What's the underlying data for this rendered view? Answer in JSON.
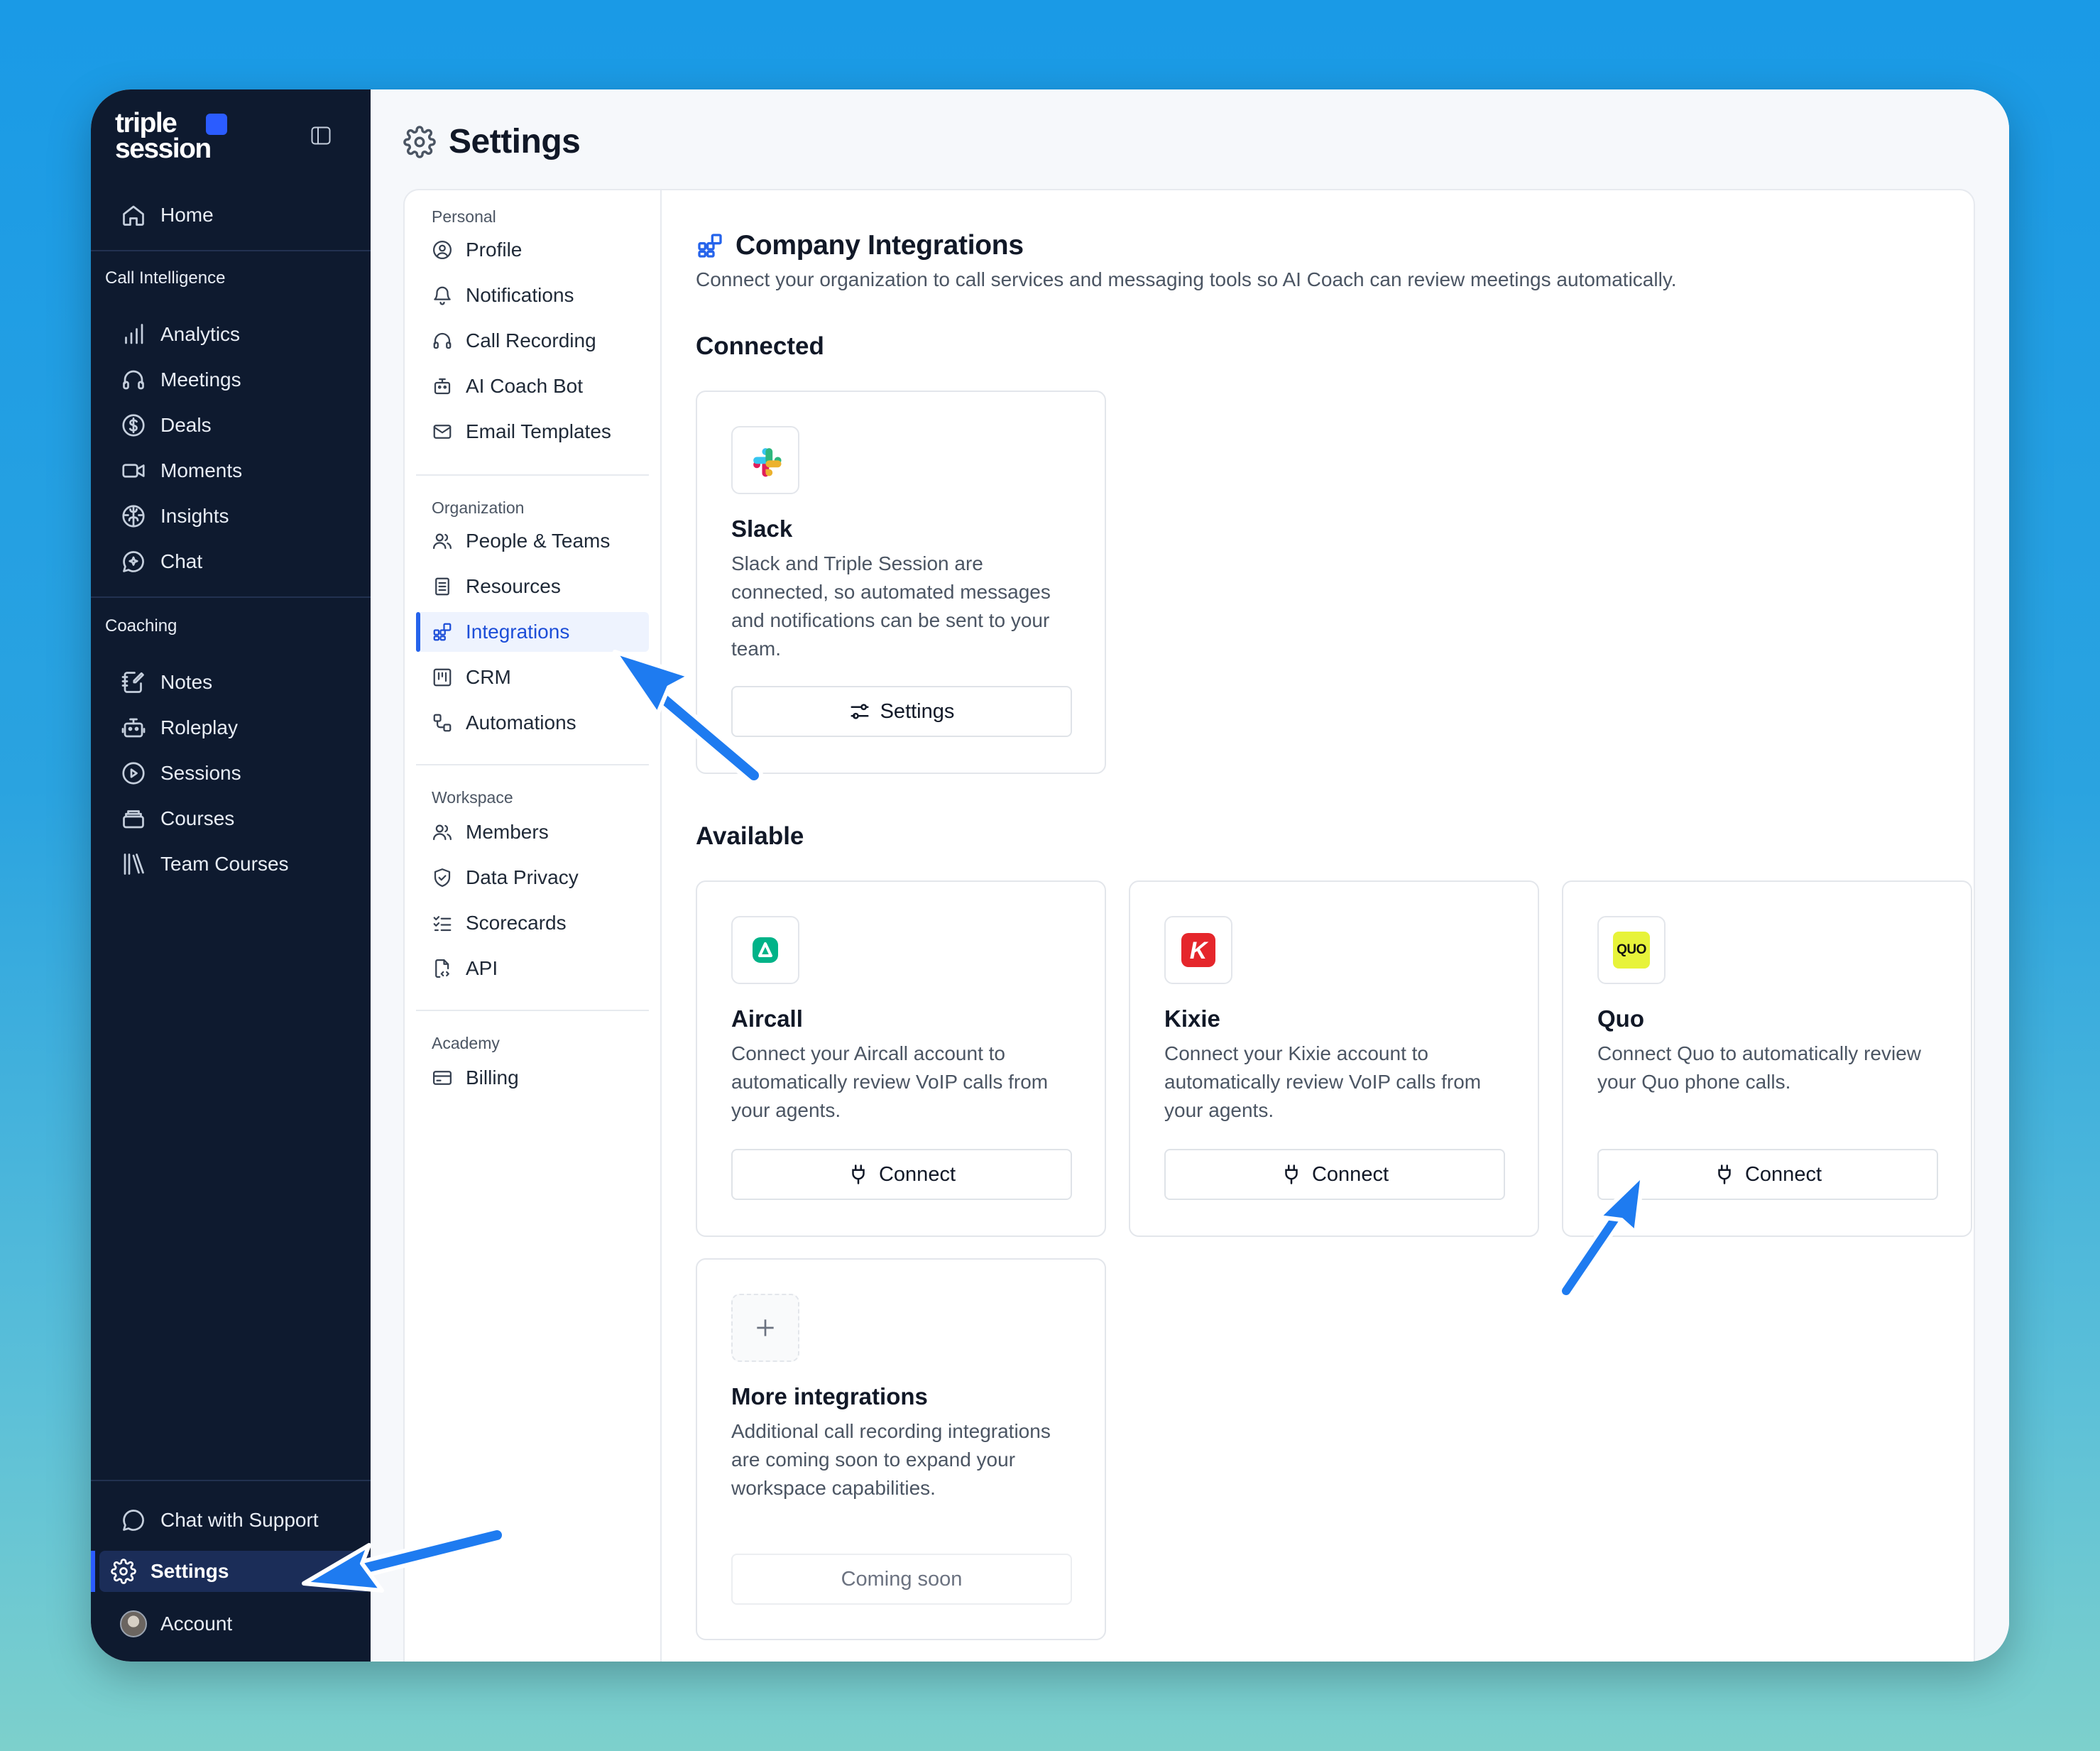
{
  "brand": {
    "line1": "triple",
    "line2": "session"
  },
  "sidebar": {
    "home": "Home",
    "section_call": "Call Intelligence",
    "call_items": [
      "Analytics",
      "Meetings",
      "Deals",
      "Moments",
      "Insights",
      "Chat"
    ],
    "section_coaching": "Coaching",
    "coaching_items": [
      "Notes",
      "Roleplay",
      "Sessions",
      "Courses",
      "Team Courses"
    ],
    "support": "Chat with Support",
    "settings": "Settings",
    "account": "Account",
    "accent": "#2b5cff"
  },
  "page": {
    "title": "Settings"
  },
  "settings_nav": {
    "personal_heading": "Personal",
    "personal": [
      "Profile",
      "Notifications",
      "Call Recording",
      "AI Coach Bot",
      "Email Templates"
    ],
    "organization_heading": "Organization",
    "organization": [
      "People & Teams",
      "Resources",
      "Integrations",
      "CRM",
      "Automations"
    ],
    "workspace_heading": "Workspace",
    "workspace": [
      "Members",
      "Data Privacy",
      "Scorecards",
      "API"
    ],
    "academy_heading": "Academy",
    "academy": [
      "Billing"
    ],
    "active": "Integrations"
  },
  "integrations": {
    "title": "Company Integrations",
    "subtitle": "Connect your organization to call services and messaging tools so AI Coach can review meetings automatically.",
    "connected_heading": "Connected",
    "available_heading": "Available",
    "slack": {
      "name": "Slack",
      "desc": "Slack and Triple Session are connected, so automated messages and notifications can be sent to your team.",
      "button": "Settings"
    },
    "aircall": {
      "name": "Aircall",
      "desc": "Connect your Aircall account to automatically review VoIP calls from your agents.",
      "button": "Connect"
    },
    "kixie": {
      "name": "Kixie",
      "desc": "Connect your Kixie account to automatically review VoIP calls from your agents.",
      "button": "Connect"
    },
    "quo": {
      "name": "Quo",
      "logo_text": "QUO",
      "desc": "Connect Quo to automatically review your Quo phone calls.",
      "button": "Connect"
    },
    "more": {
      "name": "More integrations",
      "desc": "Additional call recording integrations are coming soon to expand your workspace capabilities.",
      "button": "Coming soon"
    }
  },
  "colors": {
    "arrow": "#1e7bf0",
    "active_blue": "#2563eb",
    "sidebar_bg": "#0e1a2f"
  }
}
